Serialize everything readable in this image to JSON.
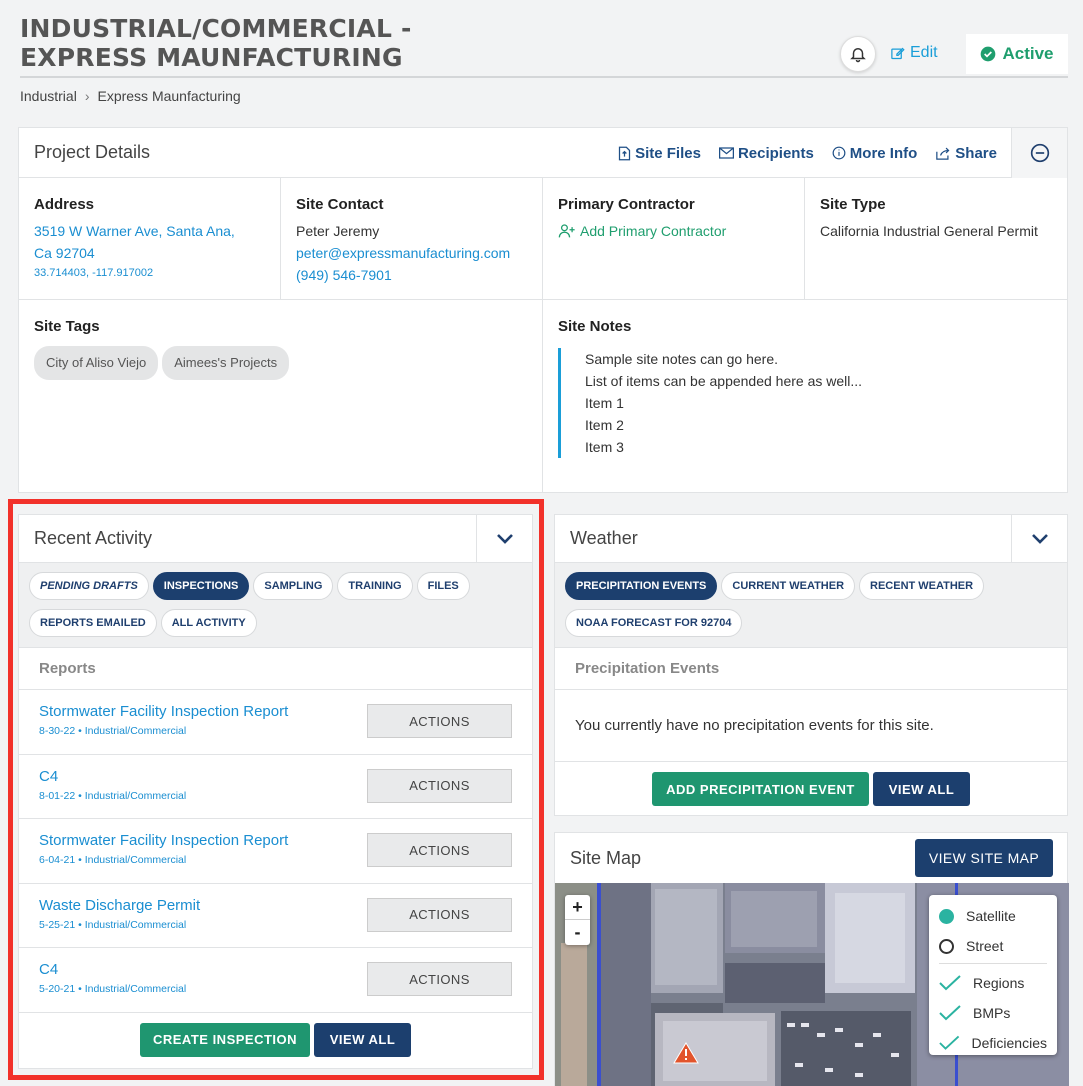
{
  "header": {
    "title": "INDUSTRIAL/COMMERCIAL - EXPRESS MAUNFACTURING",
    "edit_label": "Edit",
    "status_label": "Active"
  },
  "breadcrumb": [
    "Industrial",
    "Express Maunfacturing"
  ],
  "project_details": {
    "title": "Project Details",
    "links": [
      "Site Files",
      "Recipients",
      "More Info",
      "Share"
    ],
    "address": {
      "label": "Address",
      "line1": "3519 W Warner Ave, Santa Ana,",
      "line2": "Ca 92704",
      "coords": "33.714403, -117.917002"
    },
    "site_contact": {
      "label": "Site Contact",
      "name": "Peter Jeremy",
      "email": "peter@expressmanufacturing.com",
      "phone": "(949) 546-7901"
    },
    "primary_contractor": {
      "label": "Primary Contractor",
      "add_label": "Add Primary Contractor"
    },
    "site_type": {
      "label": "Site Type",
      "value": "California Industrial General Permit"
    },
    "site_tags": {
      "label": "Site Tags",
      "tags": [
        "City of Aliso Viejo",
        "Aimees's Projects"
      ]
    },
    "site_notes": {
      "label": "Site Notes",
      "lines": [
        "Sample site notes can go here.",
        "List of items can be appended here as well...",
        "Item 1",
        "Item 2",
        "Item 3"
      ]
    }
  },
  "recent_activity": {
    "title": "Recent Activity",
    "tabs": [
      "PENDING DRAFTS",
      "INSPECTIONS",
      "SAMPLING",
      "TRAINING",
      "FILES",
      "REPORTS EMAILED",
      "ALL ACTIVITY"
    ],
    "active_tab": "INSPECTIONS",
    "section_label": "Reports",
    "reports": [
      {
        "title": "Stormwater Facility Inspection Report",
        "meta": "8-30-22 • Industrial/Commercial"
      },
      {
        "title": "C4",
        "meta": "8-01-22 • Industrial/Commercial"
      },
      {
        "title": "Stormwater Facility Inspection Report",
        "meta": "6-04-21 • Industrial/Commercial"
      },
      {
        "title": "Waste Discharge Permit",
        "meta": "5-25-21 • Industrial/Commercial"
      },
      {
        "title": "C4",
        "meta": "5-20-21 • Industrial/Commercial"
      }
    ],
    "actions_label": "ACTIONS",
    "create_label": "CREATE INSPECTION",
    "view_all_label": "VIEW ALL"
  },
  "weather": {
    "title": "Weather",
    "tabs": [
      "PRECIPITATION EVENTS",
      "CURRENT WEATHER",
      "RECENT WEATHER",
      "NOAA FORECAST FOR 92704"
    ],
    "active_tab": "PRECIPITATION EVENTS",
    "section_label": "Precipitation Events",
    "empty_message": "You currently have no precipitation events for this site.",
    "add_label": "ADD PRECIPITATION EVENT",
    "view_all_label": "VIEW ALL"
  },
  "site_map": {
    "title": "Site Map",
    "view_label": "VIEW SITE MAP",
    "zoom_in": "+",
    "zoom_out": "-",
    "base_layers": [
      "Satellite",
      "Street"
    ],
    "selected_base": "Satellite",
    "overlays": [
      "Regions",
      "BMPs",
      "Deficiencies"
    ]
  },
  "colors": {
    "accent_blue": "#1a8ed1",
    "navy": "#1c3f6e",
    "green": "#1f9670",
    "highlight": "#f2312a"
  }
}
